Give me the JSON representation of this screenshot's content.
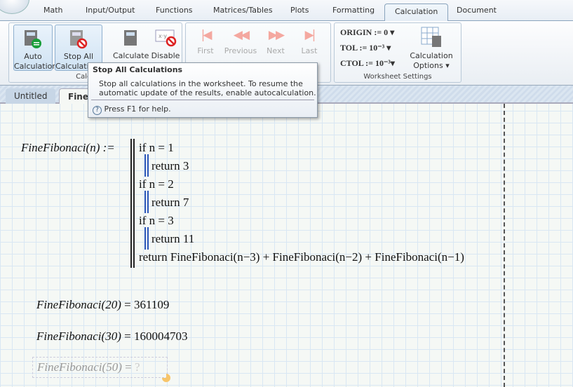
{
  "ribbon_tabs": [
    "Math",
    "Input/Output",
    "Functions",
    "Matrices/Tables",
    "Plots",
    "Formatting",
    "Calculation",
    "Document"
  ],
  "active_tab": "Calculation",
  "calc_group": {
    "auto": "Auto Calculation",
    "stop": "Stop All Calculations",
    "calculate": "Calculate",
    "disable": "Disable Regions",
    "label": "Calculation"
  },
  "nav": {
    "first": "First",
    "previous": "Previous",
    "next": "Next",
    "last": "Last"
  },
  "settings": {
    "origin": "ORIGIN := 0",
    "tol": "TOL := 10⁻³",
    "ctol": "CTOL := 10⁻³",
    "options": "Calculation Options",
    "label": "Worksheet Settings"
  },
  "doc_tabs": [
    "Untitled",
    "FineF"
  ],
  "tooltip": {
    "title": "Stop All Calculations",
    "body": "Stop all calculations in the worksheet. To resume the automatic update of the results, enable autocalculation.",
    "help": "Press F1 for help."
  },
  "program": {
    "def": "FineFibonaci(n) :=",
    "lines": [
      "if n = 1",
      "return 3",
      "if n = 2",
      "return 7",
      "if n = 3",
      "return 11",
      "return FineFibonaci(n−3) + FineFibonaci(n−2) + FineFibonaci(n−1)"
    ]
  },
  "results": [
    {
      "expr": "FineFibonaci(20)",
      "value": "361109"
    },
    {
      "expr": "FineFibonaci(30)",
      "value": "160004703"
    },
    {
      "expr": "FineFibonaci(50)",
      "value": "?",
      "pending": true
    }
  ],
  "colors": {
    "accent": "#2a56b8",
    "nav_disabled": "#f4a8a0"
  }
}
